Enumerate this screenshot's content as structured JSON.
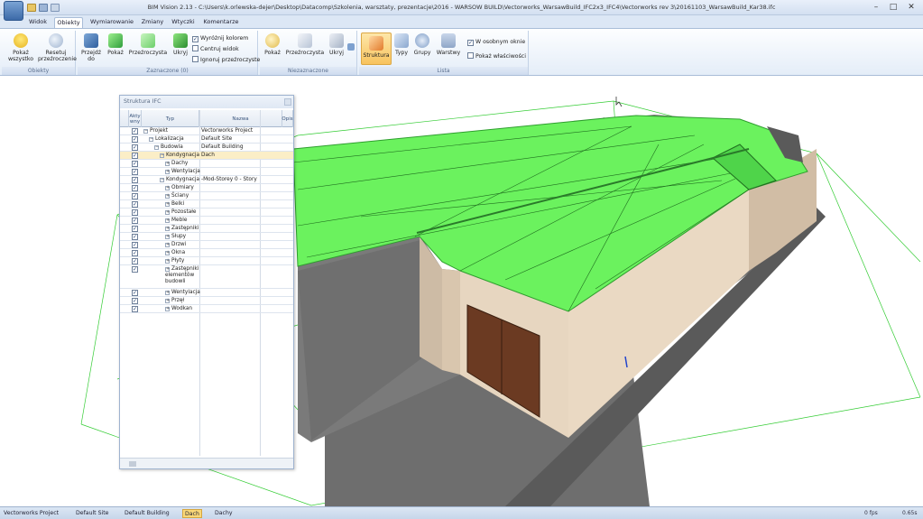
{
  "window": {
    "title": "BIM Vision 2.13 - C:\\Users\\k.orlewska-dejer\\Desktop\\Datacomp\\Szkolenia, warsztaty, prezentacje\\2016 - WARSOW BUILD\\Vectorworks_WarsawBuild_IFC2x3_IFC4\\Vectorworks rev 3\\20161103_WarsawBuild_Kar38.ifc",
    "minimize": "–",
    "maximize": "□",
    "close": "✕"
  },
  "tabs": [
    {
      "label": "Widok"
    },
    {
      "label": "Obiekty"
    },
    {
      "label": "Wymiarowanie"
    },
    {
      "label": "Zmiany"
    },
    {
      "label": "Wtyczki"
    },
    {
      "label": "Komentarze"
    }
  ],
  "ribbon": {
    "groups": {
      "obiekty": "Obiekty",
      "zaznaczone": "Zaznaczone (0)",
      "niezaznaczone": "Niezaznaczone",
      "lista": "Lista"
    },
    "buttons": {
      "pokaz_wszystko": "Pokaż wszystko",
      "resetuj": "Resetuj przeźroczenie",
      "przejdz": "Przejdź do",
      "pokaz": "Pokaż",
      "przezroczysta": "Przeźroczysta",
      "ukryj": "Ukryj",
      "pokaz2": "Pokaż",
      "przezroczysta2": "Przeźroczysta",
      "ukryj2": "Ukryj",
      "struktura": "Struktura",
      "typy": "Typy",
      "grupy": "Grupy",
      "warstwy": "Warstwy"
    },
    "checks": {
      "wyroznij": "Wyróżnij kolorem",
      "centruj": "Centruj widok",
      "ignoruj": "Ignoruj przeźroczyste",
      "w_osobnym": "W osobnym oknie",
      "pokaz_wlasciwosci": "Pokaż właściwości"
    }
  },
  "panel": {
    "title": "Struktura IFC",
    "col_aktywny": "Akty wny",
    "col_typ": "Typ",
    "col_nazwa": "Nazwa",
    "col_opis": "Opis",
    "check_mark": "✓",
    "rows": [
      {
        "type": "Projekt",
        "name": "Vectorworks Project",
        "exp": "−"
      },
      {
        "type": "Lokalizacja",
        "name": "Default Site",
        "exp": "−"
      },
      {
        "type": "Budowla",
        "name": "Default Building",
        "exp": "−"
      },
      {
        "type": "Kondygnacja",
        "name": "Dach",
        "exp": "−"
      },
      {
        "type": "Dachy",
        "name": "",
        "exp": "+"
      },
      {
        "type": "Wentylacja",
        "name": "",
        "exp": "+"
      },
      {
        "type": "Kondygnacja",
        "name": "-Mod-Storey 0 - Story",
        "exp": "−"
      },
      {
        "type": "Obmiary",
        "name": "",
        "exp": "+"
      },
      {
        "type": "Ściany",
        "name": "",
        "exp": "+"
      },
      {
        "type": "Belki",
        "name": "",
        "exp": "+"
      },
      {
        "type": "Pozostałe",
        "name": "",
        "exp": "+"
      },
      {
        "type": "Meble",
        "name": "",
        "exp": "+"
      },
      {
        "type": "Zastępniki",
        "name": "",
        "exp": "+"
      },
      {
        "type": "Słupy",
        "name": "",
        "exp": "+"
      },
      {
        "type": "Drzwi",
        "name": "",
        "exp": "+"
      },
      {
        "type": "Okna",
        "name": "",
        "exp": "+"
      },
      {
        "type": "Płyty",
        "name": "",
        "exp": "+"
      },
      {
        "type": "Zastępniki elementów budowli",
        "name": "",
        "exp": "+"
      },
      {
        "type": "Wentylacja",
        "name": "",
        "exp": "+"
      },
      {
        "type": "Przęł",
        "name": "",
        "exp": "+"
      },
      {
        "type": "Wodkan",
        "name": "",
        "exp": "+"
      }
    ]
  },
  "statusbar": {
    "crumbs": [
      "Vectorworks Project",
      "Default Site",
      "Default Building",
      "Dach",
      "Dachy"
    ],
    "fps": "0 fps",
    "right": "0.65s"
  },
  "colors": {
    "roof": "#6bf25e",
    "wall": "#e4d2bc",
    "wall_shadow": "#c9b49d",
    "floor": "#777777",
    "door": "#6b3a22",
    "accent": "#f8c35e"
  }
}
